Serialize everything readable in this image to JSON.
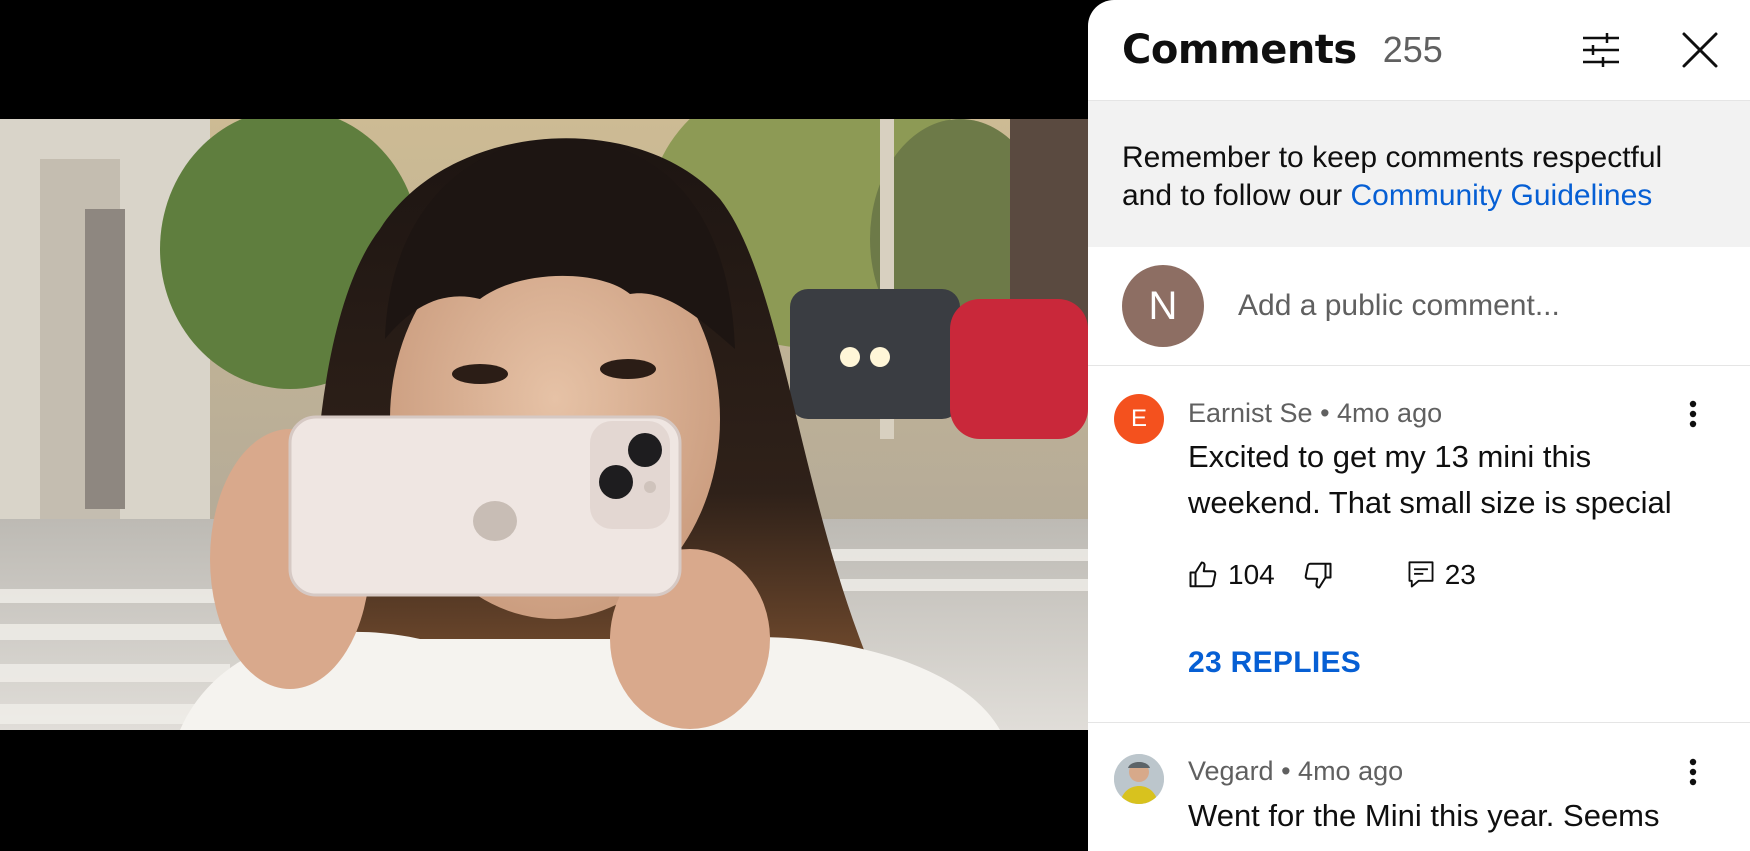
{
  "panel": {
    "title": "Comments",
    "count": "255"
  },
  "guidelines": {
    "text": "Remember to keep comments respectful and to follow our ",
    "link": "Community Guidelines"
  },
  "add_comment": {
    "avatar_initial": "N",
    "placeholder": "Add a public comment..."
  },
  "comments": [
    {
      "avatar_initial": "E",
      "author": "Earnist Se",
      "time": "4mo ago",
      "text": "Excited to get my 13 mini this weekend. That small size is special",
      "likes": "104",
      "reply_count": "23",
      "replies_label": "23 REPLIES"
    },
    {
      "author": "Vegard",
      "time": "4mo ago",
      "text": "Went for the Mini this year. Seems"
    }
  ],
  "icons": {
    "filter": "sliders-icon",
    "close": "close-icon",
    "more": "more-vert-icon",
    "like": "thumb-up-icon",
    "dislike": "thumb-down-icon",
    "reply": "comment-icon"
  },
  "colors": {
    "link": "#065fd4",
    "avatar_n": "#8d6e63",
    "avatar_e": "#f4511e"
  }
}
